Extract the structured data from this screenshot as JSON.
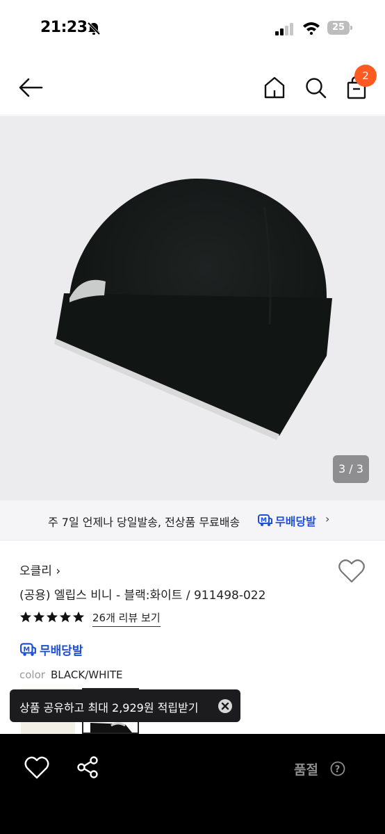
{
  "status_bar": {
    "time": "21:23",
    "battery_level": "25"
  },
  "header": {
    "cart_count": "2"
  },
  "gallery": {
    "counter": "3 / 3"
  },
  "shipping_banner": {
    "text": "주 7일 언제나 당일발송, 전상품 무료배송",
    "badge_label": "무배당발",
    "chevron": "›"
  },
  "product": {
    "brand": "오클리 ›",
    "title": "(공용) 엘립스 비니 - 블랙:화이트 / 911498-022",
    "rating_stars": 5,
    "review_link": "26개 리뷰 보기",
    "free_ship_label": "무배당발",
    "color_label": "color",
    "color_value": "BLACK/WHITE"
  },
  "toast": {
    "message": "상품 공유하고 최대 2,929원 적립받기"
  },
  "bottom_bar": {
    "status_label": "품절"
  },
  "colors": {
    "accent_blue": "#1f4fd6",
    "badge_orange": "#ff5a1f",
    "bottom_bar_bg": "#000000"
  }
}
